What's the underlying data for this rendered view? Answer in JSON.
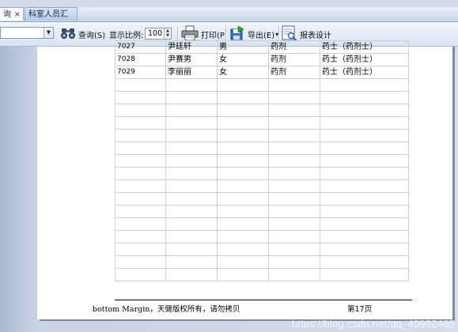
{
  "tabs": [
    {
      "label": "询",
      "close": "×"
    },
    {
      "label": "科室人员汇总表"
    }
  ],
  "toolbar": {
    "query_label": "查询(S)",
    "zoom_label": "显示比例:",
    "zoom_value": "100",
    "print_label": "打印(P)",
    "export_label": "导出(E)",
    "export_arrow": "▾",
    "design_label": "报表设计"
  },
  "table": {
    "rows": [
      [
        "7027",
        "尹廷轩",
        "男",
        "药剂",
        "药士（药剂士）"
      ],
      [
        "7028",
        "尹赛男",
        "女",
        "药剂",
        "药士（药剂士）"
      ],
      [
        "7029",
        "李丽丽",
        "女",
        "药剂",
        "药士（药剂士）"
      ]
    ],
    "empty_rows": 16
  },
  "footer": {
    "left": "bottom Margin，天健版权所有，请勿拷贝",
    "right": "第17页"
  },
  "watermark": "https://blog.csdn.net/qq_40982465",
  "colors": {
    "tab_bar": "#cbd8ea",
    "toolbar": "#d9e3f1",
    "page": "#ffffff",
    "grid_line": "#cfcfcf"
  }
}
